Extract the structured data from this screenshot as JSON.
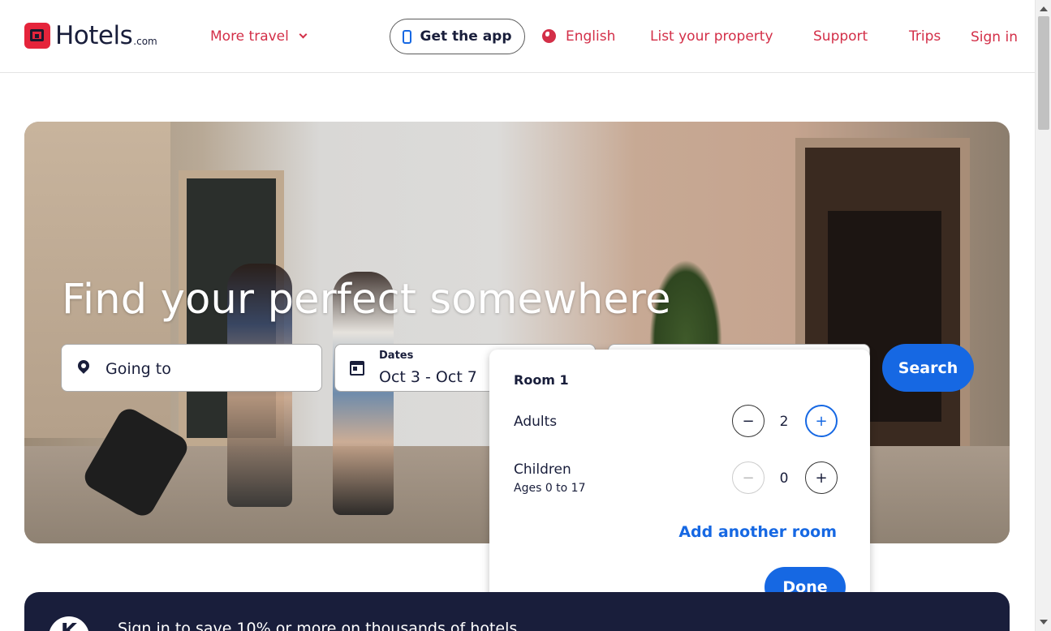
{
  "header": {
    "logo_text": "Hotels",
    "logo_suffix": ".com",
    "more_travel": "More travel",
    "get_app": "Get the app",
    "language": "English",
    "list_property": "List your property",
    "support": "Support",
    "trips": "Trips",
    "sign_in": "Sign in"
  },
  "hero": {
    "title": "Find your perfect somewhere"
  },
  "search": {
    "going_to": "Going to",
    "dates_label": "Dates",
    "dates_value": "Oct 3 - Oct 7",
    "search_button": "Search"
  },
  "travelers": {
    "room_title": "Room 1",
    "adults_label": "Adults",
    "adults_value": "2",
    "children_label": "Children",
    "children_sub": "Ages 0 to 17",
    "children_value": "0",
    "minus": "−",
    "plus": "+",
    "add_room": "Add another room",
    "done": "Done"
  },
  "banner": {
    "avatar_letter": "K",
    "text": "Sign in to save 10% or more on thousands of hotels"
  },
  "colors": {
    "brand_red": "#d32f48",
    "primary_blue": "#1668e3",
    "navy": "#191e3b"
  }
}
